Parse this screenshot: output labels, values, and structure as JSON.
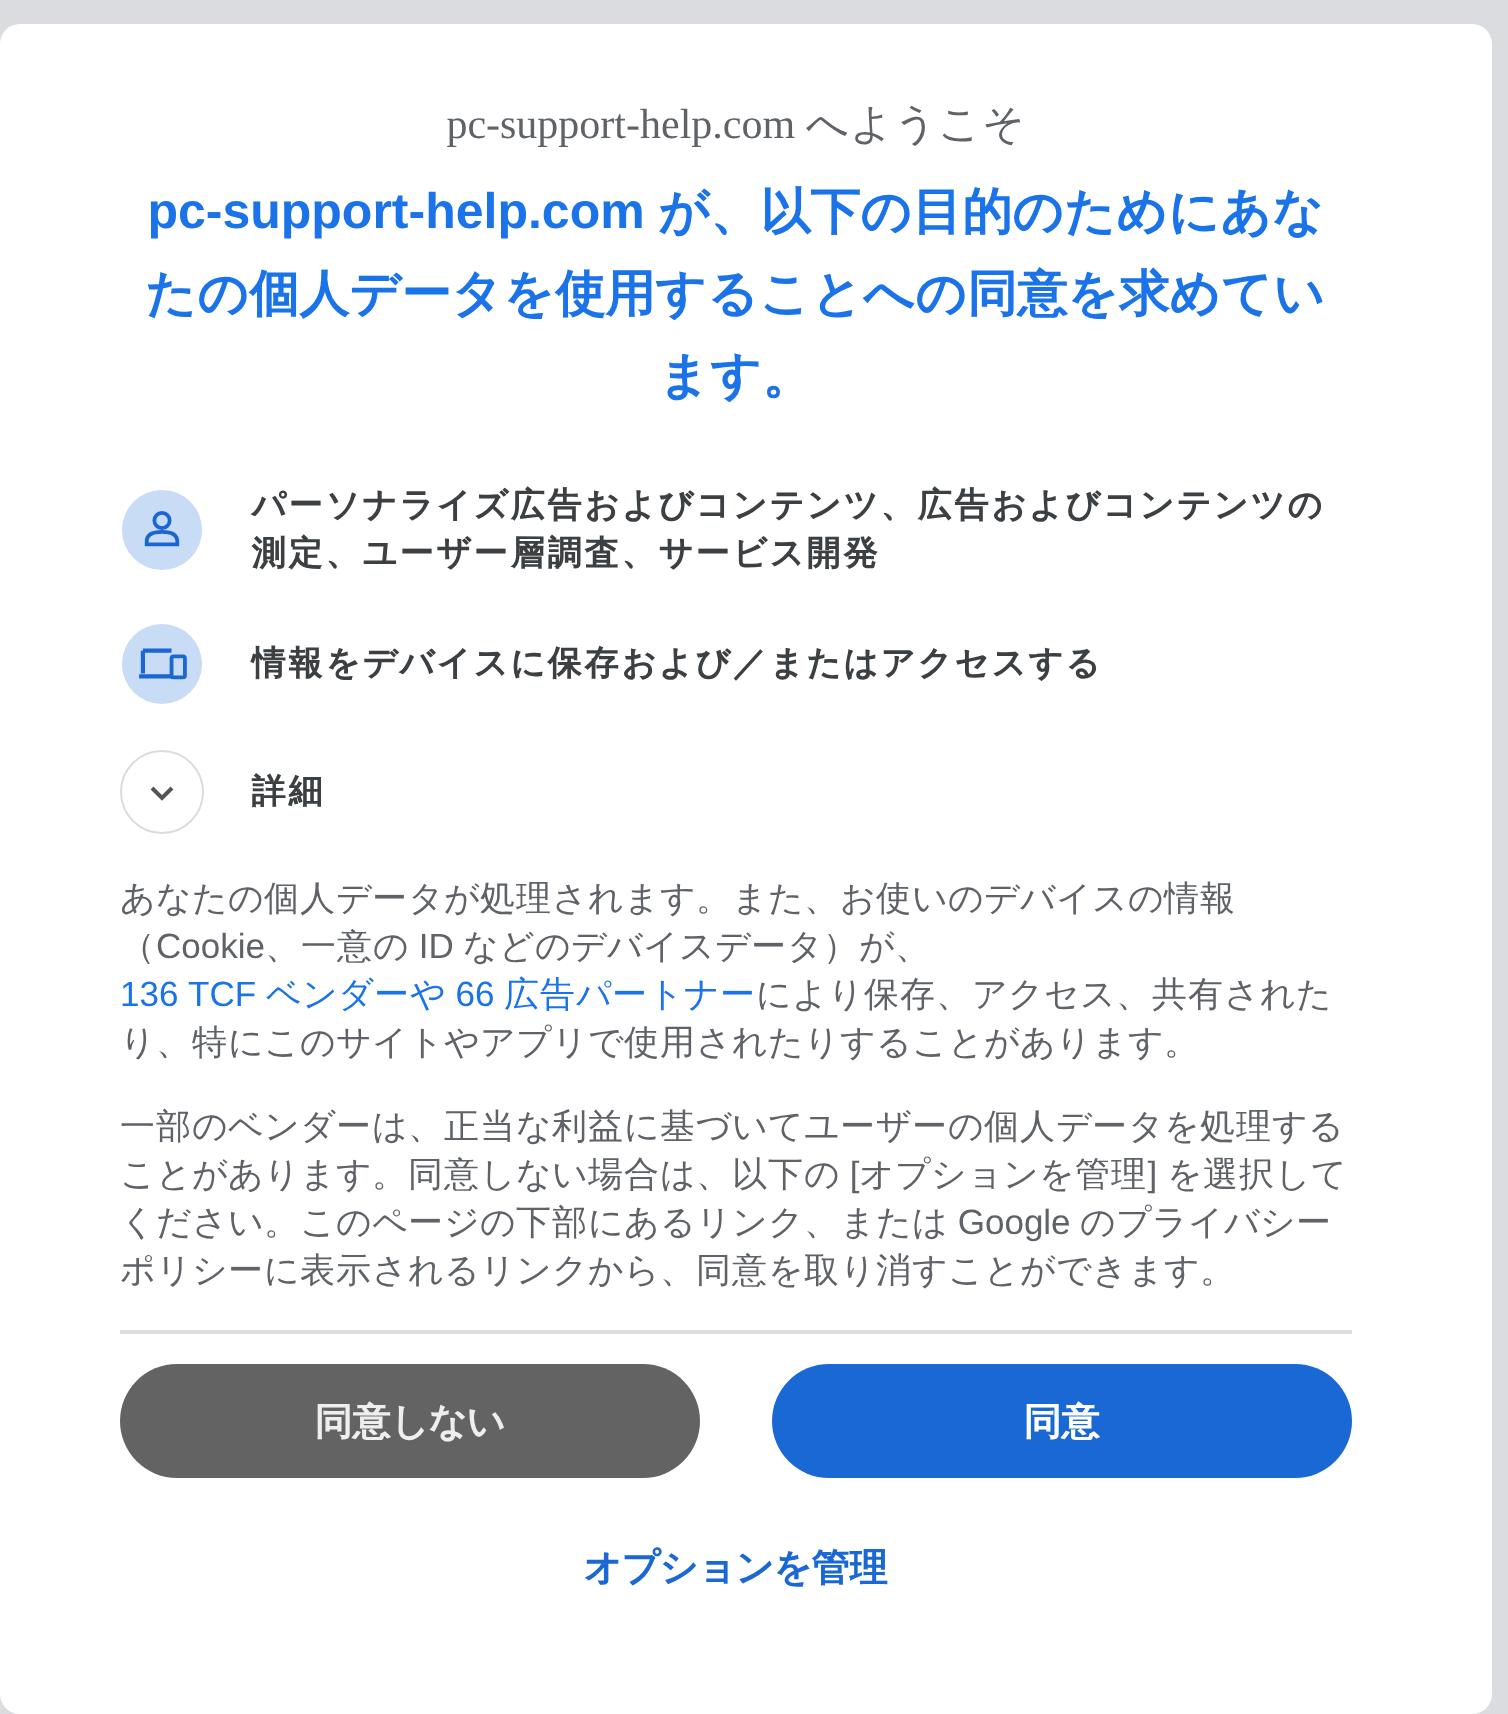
{
  "welcome": "pc-support-help.com へようこそ",
  "heading": "pc-support-help.com が、以下の目的のためにあなたの個人データを使用することへの同意を求めています。",
  "purposes": [
    {
      "kind": "person",
      "label": "パーソナライズ広告およびコンテンツ、広告およびコンテンツの測定、ユーザー層調査、サービス開発"
    },
    {
      "kind": "device",
      "label": "情報をデバイスに保存および／またはアクセスする"
    },
    {
      "kind": "expand",
      "label": "詳細",
      "expanded": false
    }
  ],
  "notice": {
    "before": "あなたの個人データが処理されます。また、お使いのデバイスの情報（Cookie、一意の ID などのデバイスデータ）が、",
    "link": "136 TCF ベンダーや 66 広告パートナー",
    "after": "により保存、アクセス、共有されたり、特にこのサイトやアプリで使用されたりすることがあります。"
  },
  "legitimate_interest": "一部のベンダーは、正当な利益に基づいてユーザーの個人データを処理することがあります。同意しない場合は、以下の [オプションを管理] を選択してください。このページの下部にあるリンク、または Google のプライバシーポリシーに表示されるリンクから、同意を取り消すことができます。",
  "buttons": [
    {
      "kind": "decline",
      "label": "同意しない"
    },
    {
      "kind": "accept",
      "label": "同意"
    }
  ],
  "manage_link": "オプションを管理"
}
